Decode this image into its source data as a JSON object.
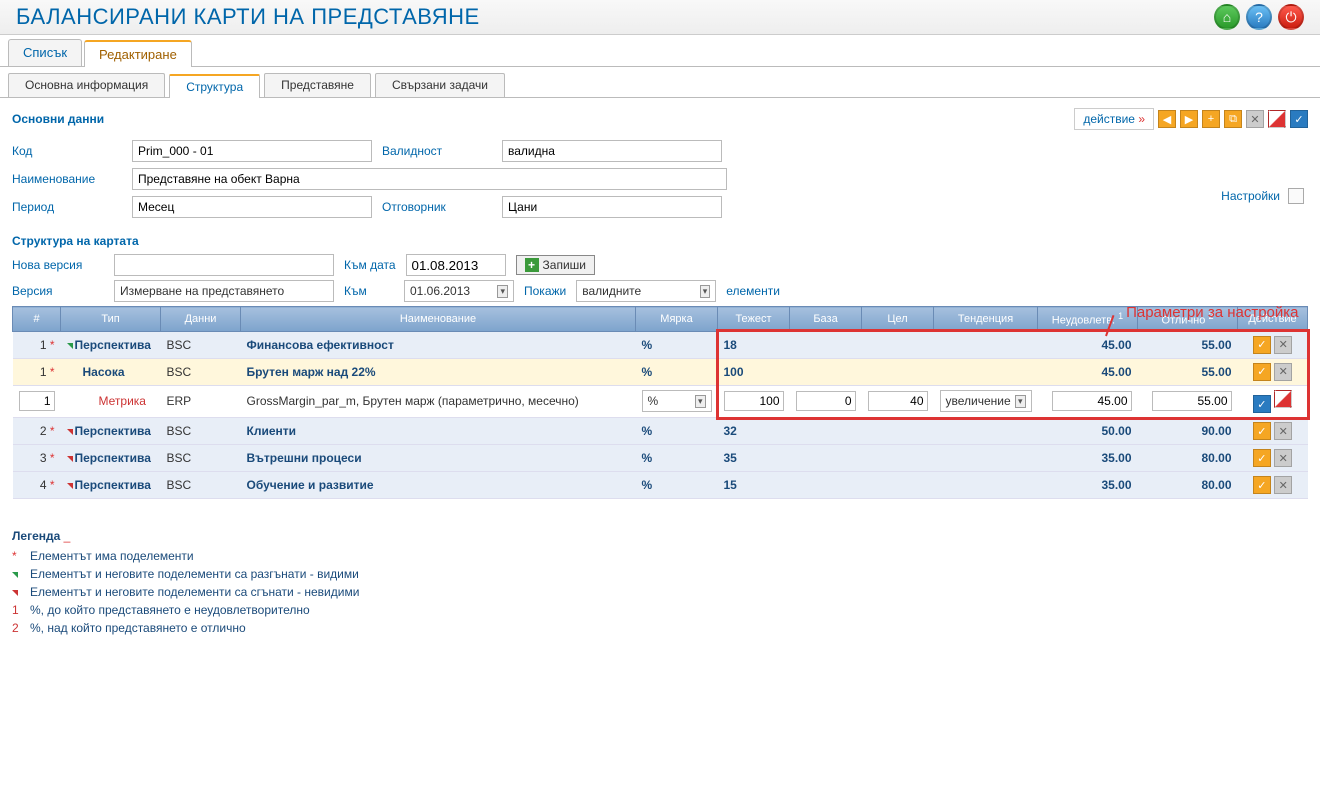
{
  "header": {
    "title": "БАЛАНСИРАНИ КАРТИ НА ПРЕДСТАВЯНЕ"
  },
  "main_tabs": {
    "list": "Списък",
    "edit": "Редактиране"
  },
  "inner_tabs": {
    "info": "Основна информация",
    "structure": "Структура",
    "presentation": "Представяне",
    "tasks": "Свързани задачи"
  },
  "sections": {
    "basic": "Основни данни",
    "structure": "Структура на картата",
    "legend": "Легенда"
  },
  "action_menu": "действие",
  "settings_label": "Настройки",
  "form": {
    "code_label": "Код",
    "code_value": "Prim_000 - 01",
    "validity_label": "Валидност",
    "validity_value": "валидна",
    "name_label": "Наименование",
    "name_value": "Представяне на обект Варна",
    "period_label": "Период",
    "period_value": "Месец",
    "responsible_label": "Отговорник",
    "responsible_value": "Цани"
  },
  "filter": {
    "new_version_label": "Нова версия",
    "new_version_value": "",
    "to_date_label": "Към дата",
    "to_date_value": "01.08.2013",
    "save_btn": "Запиши",
    "version_label": "Версия",
    "version_value": "Измерване на представянето",
    "to_label": "Към",
    "to_value": "01.06.2013",
    "show_label": "Покажи",
    "show_value": "валидните",
    "elements_label": "елементи"
  },
  "highlight_label": "Параметри за настройка",
  "table": {
    "headers": {
      "num": "#",
      "type": "Тип",
      "data": "Данни",
      "name": "Наименование",
      "measure": "Мярка",
      "weight": "Тежест",
      "base": "База",
      "target": "Цел",
      "trend": "Тенденция",
      "unsat": "Неудовлетв.",
      "excellent": "Отлично",
      "action": "Действие"
    },
    "rows": [
      {
        "idx": "1",
        "type": "Перспектива",
        "data": "BSC",
        "name": "Финансова ефективност",
        "measure": "%",
        "weight": "18",
        "unsat": "45.00",
        "excellent": "55.00",
        "cls": "row-blue",
        "bold": true,
        "marker": "g",
        "star": true
      },
      {
        "idx": "1",
        "type": "Насока",
        "data": "BSC",
        "name": "Брутен марж над 22%",
        "measure": "%",
        "weight": "100",
        "unsat": "45.00",
        "excellent": "55.00",
        "cls": "row-yellow",
        "bold": true,
        "indent": 1,
        "star": true
      },
      {
        "idx": "1",
        "type": "Метрика",
        "data": "ERP",
        "name": "GrossMargin_par_m, Брутен марж (параметрично, месечно)",
        "measure_select": "%",
        "weight_in": "100",
        "base_in": "0",
        "target_in": "40",
        "trend_in": "увеличение",
        "unsat_in": "45.00",
        "excellent_in": "55.00",
        "cls": "row-white",
        "editable": true,
        "indent": 2,
        "type_red": true
      },
      {
        "idx": "2",
        "type": "Перспектива",
        "data": "BSC",
        "name": "Клиенти",
        "measure": "%",
        "weight": "32",
        "unsat": "50.00",
        "excellent": "90.00",
        "cls": "row-blue",
        "bold": true,
        "marker": "r",
        "star": true
      },
      {
        "idx": "3",
        "type": "Перспектива",
        "data": "BSC",
        "name": "Вътрешни процеси",
        "measure": "%",
        "weight": "35",
        "unsat": "35.00",
        "excellent": "80.00",
        "cls": "row-blue",
        "bold": true,
        "marker": "r",
        "star": true
      },
      {
        "idx": "4",
        "type": "Перспектива",
        "data": "BSC",
        "name": "Обучение и развитие",
        "measure": "%",
        "weight": "15",
        "unsat": "35.00",
        "excellent": "80.00",
        "cls": "row-blue",
        "bold": true,
        "marker": "r",
        "star": true
      }
    ]
  },
  "legend": {
    "items": {
      "star": "Елементът има поделементи",
      "green": "Елементът и неговите поделементи са разгънати - видими",
      "red": "Елементът и неговите поделементи са сгънати - невидими",
      "one": "%, до който представянето е неудовлетворително",
      "two": "%, над който представянето е отлично"
    }
  }
}
